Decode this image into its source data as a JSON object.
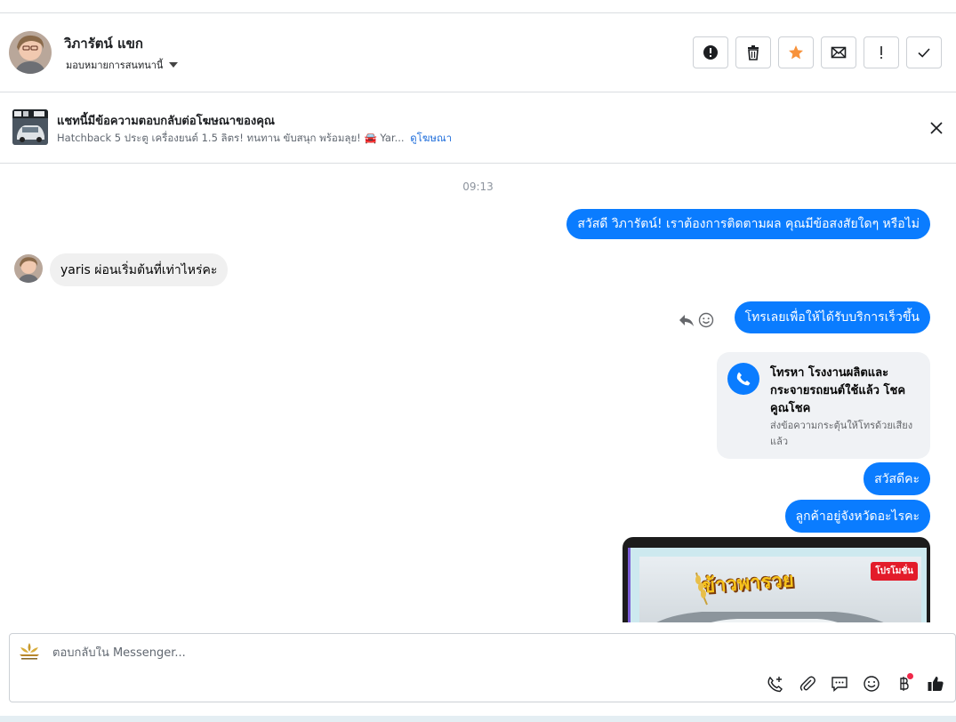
{
  "contact": {
    "name": "วิภารัตน์ แขก",
    "assign_label": "มอบหมายการสนทนานี้"
  },
  "header_actions": [
    {
      "name": "spam-button",
      "icon": "alert-circle-icon"
    },
    {
      "name": "delete-button",
      "icon": "trash-icon"
    },
    {
      "name": "star-button",
      "icon": "star-icon",
      "color": "#f7923b"
    },
    {
      "name": "mark-unread-button",
      "icon": "envelope-icon"
    },
    {
      "name": "follow-up-button",
      "icon": "exclamation-icon"
    },
    {
      "name": "mark-done-button",
      "icon": "check-icon"
    }
  ],
  "ad_banner": {
    "title": "แชทนี้มีข้อความตอบกลับต่อโฆษณาของคุณ",
    "description": "Hatchback 5 ประตู เครื่องยนต์ 1.5 ลิตร! ทนทาน ขับสนุก พร้อมลุย! 🚘 Yar...",
    "link_label": "ดูโฆษณา"
  },
  "chat": {
    "timestamp": "09:13",
    "messages": [
      {
        "direction": "out",
        "text": "สวัสดี วิภารัตน์! เราต้องการติดตามผล คุณมีข้อสงสัยใดๆ หรือไม่"
      },
      {
        "direction": "in",
        "text": "yaris ผ่อนเริ่มต้นที่เท่าไหร่คะ"
      },
      {
        "direction": "out",
        "text": "โทรเลยเพื่อให้ได้รับบริการเร็วขึ้น"
      },
      {
        "direction": "out",
        "text": "สวัสดีคะ"
      },
      {
        "direction": "out",
        "text": "ลูกค้าอยู่จังหวัดอะไรคะ"
      }
    ],
    "call_card": {
      "title": "โทรหา โรงงานผลิตและกระจายรถยนต์ใช้แล้ว โชคคูณโชค",
      "subtitle": "ส่งข้อความกระตุ้นให้โทรด้วยเสียงแล้ว"
    },
    "promo_image": {
      "badge": "โปรโมชั่น",
      "headline": "ข้าวพารวย"
    }
  },
  "composer": {
    "placeholder": "ตอบกลับใน Messenger..."
  },
  "colors": {
    "accent": "#0a7cff",
    "star": "#f7923b",
    "link": "#216fdb"
  }
}
